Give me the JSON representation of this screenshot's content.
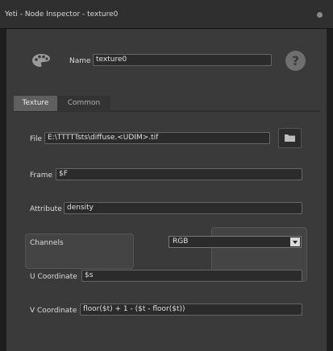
{
  "window": {
    "title": "Yeti - Node Inspector - texture0"
  },
  "header": {
    "name_label": "Name",
    "name_value": "texture0",
    "help_glyph": "?"
  },
  "tabs": [
    {
      "label": "Texture"
    },
    {
      "label": "Common"
    }
  ],
  "fields": {
    "file": {
      "label": "File",
      "value": "E:\\TTTTTsts\\diffuse.<UDIM>.tif"
    },
    "frame": {
      "label": "Frame",
      "value": "$F"
    },
    "attribute": {
      "label": "Attribute",
      "value": "density"
    },
    "channels": {
      "label": "Channels",
      "value": "RGB"
    },
    "u_coordinate": {
      "label": "U Coordinate",
      "value": "$s"
    },
    "v_coordinate": {
      "label": "V Coordinate",
      "value": "floor($t) + 1 - ($t - floor($t))"
    }
  },
  "icons": {
    "node_type": "palette-icon",
    "help": "help-icon",
    "browse": "folder-icon",
    "close": "close-icon"
  },
  "colors": {
    "background": "#1e1e1e",
    "panel": "#3a3a3a",
    "field": "#2b2b2b"
  }
}
